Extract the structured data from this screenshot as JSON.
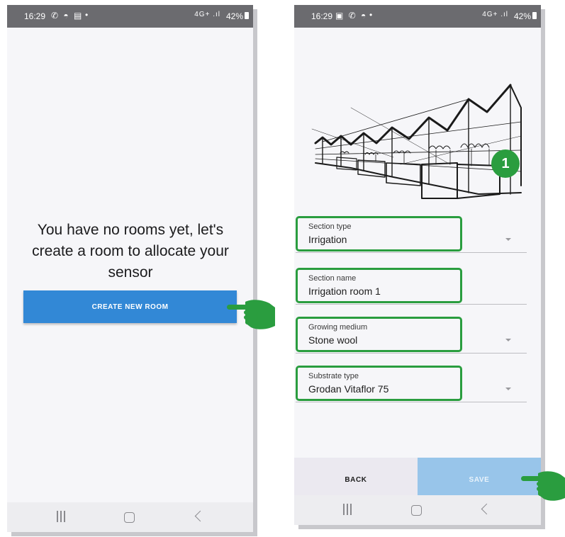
{
  "left_screen": {
    "status": {
      "time": "16:29",
      "icons": "✆ ◓ ▤",
      "dot": "•",
      "signal": "4G+ .ıl",
      "battery": "42%"
    },
    "empty_message": "You have no rooms yet, let's create a room to allocate your sensor",
    "create_button_label": "CREATE NEW ROOM"
  },
  "right_screen": {
    "status": {
      "time": "16:29",
      "icons": "▣ ✆ ◓",
      "dot": "•",
      "signal": "4G+ .ıl",
      "battery": "42%"
    },
    "step_badge": "1",
    "fields": [
      {
        "label": "Section type",
        "value": "Irrigation",
        "dropdown": true
      },
      {
        "label": "Section name",
        "value": "Irrigation room 1",
        "dropdown": false
      },
      {
        "label": "Growing medium",
        "value": "Stone wool",
        "dropdown": true
      },
      {
        "label": "Substrate type",
        "value": "Grodan Vitaflor 75",
        "dropdown": true
      }
    ],
    "back_label": "BACK",
    "save_label": "SAVE"
  },
  "colors": {
    "primary_button": "#3288d6",
    "save_button_disabled": "#98c5ea",
    "highlight_green": "#2a9d3f",
    "status_bar": "#6b6b6f"
  },
  "icons": [
    "pointing-hand-icon",
    "whatsapp-icon",
    "shopping-bag-icon",
    "gallery-icon",
    "signal-icon",
    "battery-icon",
    "nav-recent-icon",
    "nav-home-icon",
    "nav-back-icon",
    "dropdown-arrow-icon"
  ]
}
